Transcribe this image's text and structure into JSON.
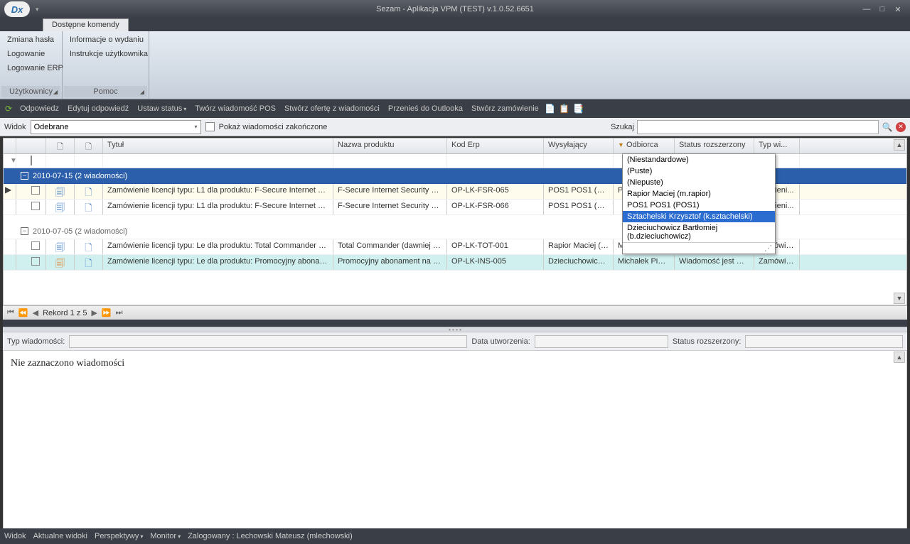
{
  "window": {
    "title": "Sezam - Aplikacja VPM (TEST) v.1.0.52.6651",
    "logo": "Dx"
  },
  "ribbon": {
    "tab": "Dostępne komendy",
    "group1": {
      "items": [
        "Zmiana hasła",
        "Logowanie",
        "Logowanie ERP"
      ],
      "footer": "Użytkownicy"
    },
    "group2": {
      "items": [
        "Informacje o wydaniu",
        "Instrukcje użytkownika"
      ],
      "footer": "Pomoc"
    }
  },
  "toolbar": {
    "items": [
      "Odpowiedz",
      "Edytuj odpowiedź",
      "Ustaw status",
      "Twórz wiadomość POS",
      "Stwórz ofertę z wiadomości",
      "Przenieś do Outlooka",
      "Stwórz zamówienie"
    ]
  },
  "viewbar": {
    "widok_label": "Widok",
    "widok_value": "Odebrane",
    "pokaz": "Pokaż wiadomości zakończone",
    "szukaj_label": "Szukaj"
  },
  "columns": {
    "tytul": "Tytuł",
    "prod": "Nazwa produktu",
    "erp": "Kod Erp",
    "wys": "Wysyłający",
    "odb": "Odbiorca",
    "stat": "Status rozszerzony",
    "typ": "Typ wi..."
  },
  "group1": {
    "header": "2010-07-15 (2 wiadomości)"
  },
  "rows1": [
    {
      "tytul": "Zamówienie licencji typu: L1 dla produktu: F-Secure Internet Se...",
      "prod": "F-Secure Internet Security 20...",
      "erp": "OP-LK-FSR-065",
      "wys": "POS1 POS1 (POS1)",
      "odb": "POS1 POS1 (POS1)",
      "stat": "",
      "typ": "mówieni..."
    },
    {
      "tytul": "Zamówienie licencji typu: L1 dla produktu: F-Secure Internet Se...",
      "prod": "F-Secure Internet Security 20...",
      "erp": "OP-LK-FSR-066",
      "wys": "POS1 POS1 (POS1)",
      "odb": "",
      "stat": "",
      "typ": "mówieni..."
    }
  ],
  "group2": {
    "header": "2010-07-05 (2 wiadomości)"
  },
  "rows2": [
    {
      "tytul": "Zamówienie licencji typu: Le dla produktu: Total Commander (da...",
      "prod": "Total Commander (dawniej Wi...",
      "erp": "OP-LK-TOT-001",
      "wys": "Rapior Maciej (m.r...",
      "odb": "Michałek Piot...",
      "stat": "Wiadomość przeczy...",
      "typ": "Zamówieni..."
    },
    {
      "tytul": "Zamówienie licencji typu: Le dla produktu: Promocyjny abonam...",
      "prod": "Promocyjny abonament na ule...",
      "erp": "OP-LK-INS-005",
      "wys": "Dzieciuchowicz Bar...",
      "odb": "Michałek Piot...",
      "stat": "Wiadomość jest w t...",
      "typ": "Zamówieni..."
    }
  ],
  "dropdown": {
    "items": [
      "(Niestandardowe)",
      "(Puste)",
      "(Niepuste)",
      "Rapior Maciej (m.rapior)",
      "POS1 POS1 (POS1)",
      "Sztachelski Krzysztof (k.sztachelski)",
      "Dzieciuchowicz Bartłomiej (b.dzieciuchowicz)"
    ],
    "selected_index": 5
  },
  "pager": {
    "label": "Rekord 1 z 5"
  },
  "detail": {
    "typ": "Typ wiadomości:",
    "data": "Data utworzenia:",
    "status": "Status rozszerzony:"
  },
  "preview": {
    "msg": "Nie zaznaczono wiadomości"
  },
  "statusbar": {
    "widok": "Widok",
    "aktualne": "Aktualne widoki",
    "persp": "Perspektywy",
    "monitor": "Monitor",
    "zalog": "Zalogowany : Lechowski Mateusz (mlechowski)"
  }
}
